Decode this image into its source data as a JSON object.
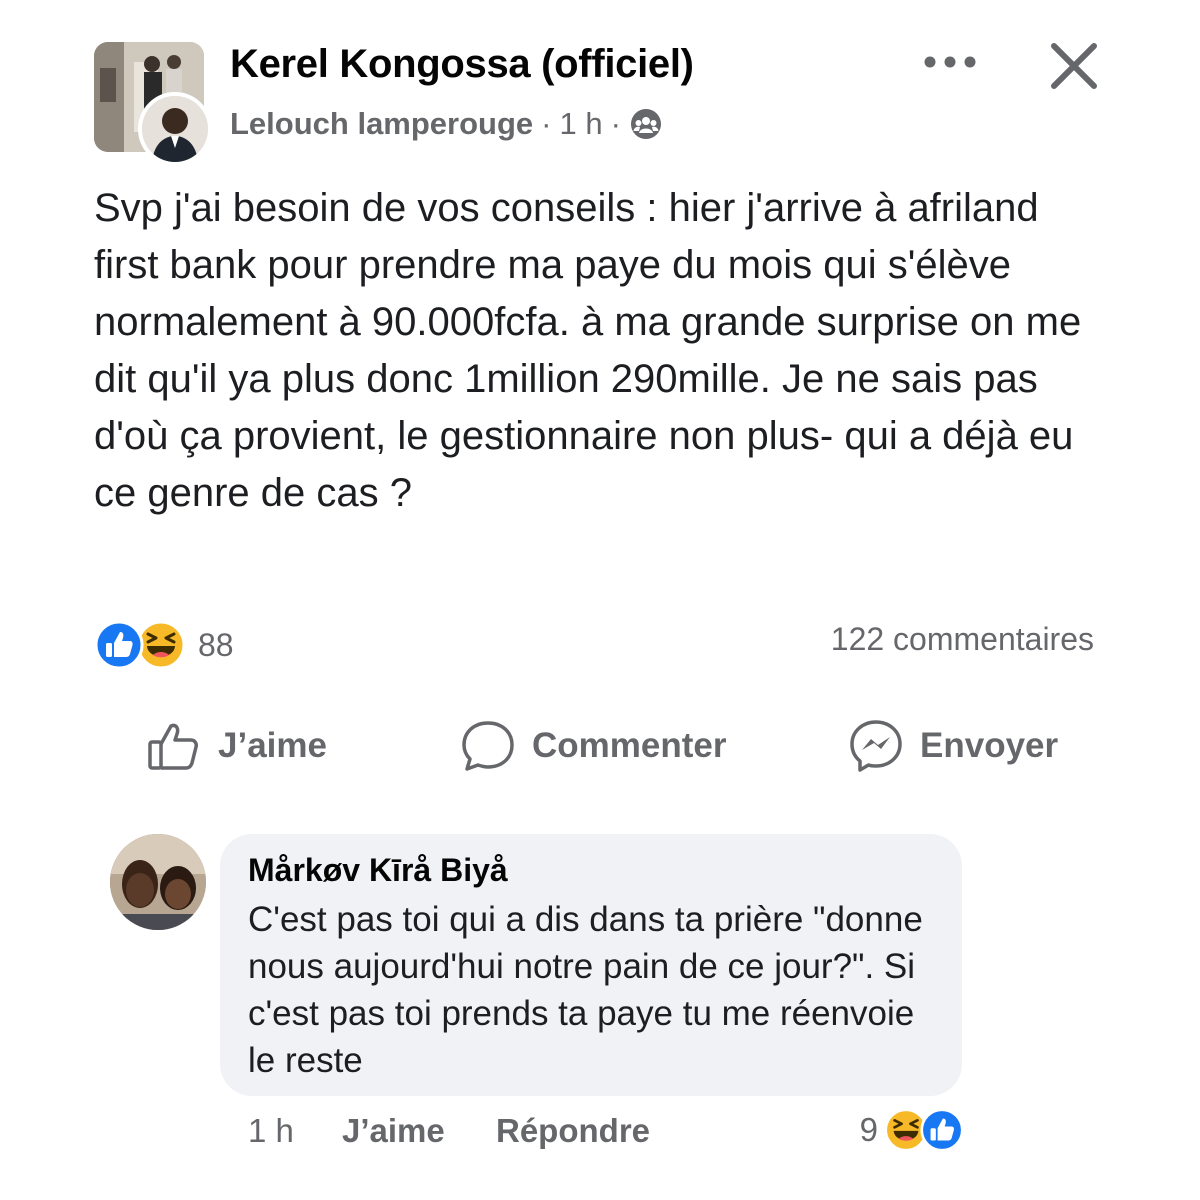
{
  "post": {
    "page_name": "Kerel Kongossa (officiel)",
    "author": "Lelouch lamperouge",
    "separator": "·",
    "time": "1 h",
    "text": "Svp j'ai besoin de vos conseils : hier j'arrive à afriland first bank pour prendre ma paye du mois qui s'élève normalement à 90.000fcfa. à ma grande surprise on me dit qu'il ya plus donc 1million 290mille. Je ne sais pas d'où ça provient, le gestionnaire non plus- qui a déjà eu ce genre de cas ?",
    "reaction_count": "88",
    "reaction_icons": [
      "like-icon",
      "haha-icon"
    ],
    "comments_count": "122 commentaires"
  },
  "actions": {
    "like_label": "J’aime",
    "comment_label": "Commenter",
    "send_label": "Envoyer"
  },
  "comment": {
    "name": "Mårkøv Kīrå Biyå",
    "text": "C'est pas toi qui a dis dans ta prière \"donne nous aujourd'hui notre pain de ce jour?\". Si c'est pas toi prends ta paye tu me réenvoie le reste",
    "time": "1 h",
    "like_label": "J’aime",
    "reply_label": "Répondre",
    "reaction_count": "9",
    "reaction_icons": [
      "haha-icon",
      "like-icon"
    ]
  },
  "colors": {
    "accent_blue": "#1877f2",
    "muted_text": "#65676b",
    "bubble_bg": "#f0f2f5",
    "haha_yellow": "#f7b928"
  }
}
